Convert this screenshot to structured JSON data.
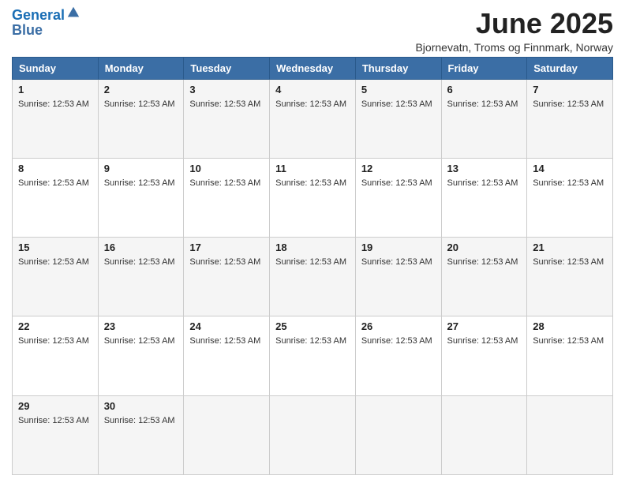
{
  "header": {
    "logo_line1": "General",
    "logo_line2": "Blue",
    "month_title": "June 2025",
    "location": "Bjornevatn, Troms og Finnmark, Norway"
  },
  "days_of_week": [
    "Sunday",
    "Monday",
    "Tuesday",
    "Wednesday",
    "Thursday",
    "Friday",
    "Saturday"
  ],
  "sunrise_time": "Sunrise: 12:53 AM",
  "weeks": [
    [
      {
        "day": "1",
        "info": "Sunrise: 12:53 AM"
      },
      {
        "day": "2",
        "info": "Sunrise: 12:53 AM"
      },
      {
        "day": "3",
        "info": "Sunrise: 12:53 AM"
      },
      {
        "day": "4",
        "info": "Sunrise: 12:53 AM"
      },
      {
        "day": "5",
        "info": "Sunrise: 12:53 AM"
      },
      {
        "day": "6",
        "info": "Sunrise: 12:53 AM"
      },
      {
        "day": "7",
        "info": "Sunrise: 12:53 AM"
      }
    ],
    [
      {
        "day": "8",
        "info": "Sunrise: 12:53 AM"
      },
      {
        "day": "9",
        "info": "Sunrise: 12:53 AM"
      },
      {
        "day": "10",
        "info": "Sunrise: 12:53 AM"
      },
      {
        "day": "11",
        "info": "Sunrise: 12:53 AM"
      },
      {
        "day": "12",
        "info": "Sunrise: 12:53 AM"
      },
      {
        "day": "13",
        "info": "Sunrise: 12:53 AM"
      },
      {
        "day": "14",
        "info": "Sunrise: 12:53 AM"
      }
    ],
    [
      {
        "day": "15",
        "info": "Sunrise: 12:53 AM"
      },
      {
        "day": "16",
        "info": "Sunrise: 12:53 AM"
      },
      {
        "day": "17",
        "info": "Sunrise: 12:53 AM"
      },
      {
        "day": "18",
        "info": "Sunrise: 12:53 AM"
      },
      {
        "day": "19",
        "info": "Sunrise: 12:53 AM"
      },
      {
        "day": "20",
        "info": "Sunrise: 12:53 AM"
      },
      {
        "day": "21",
        "info": "Sunrise: 12:53 AM"
      }
    ],
    [
      {
        "day": "22",
        "info": "Sunrise: 12:53 AM"
      },
      {
        "day": "23",
        "info": "Sunrise: 12:53 AM"
      },
      {
        "day": "24",
        "info": "Sunrise: 12:53 AM"
      },
      {
        "day": "25",
        "info": "Sunrise: 12:53 AM"
      },
      {
        "day": "26",
        "info": "Sunrise: 12:53 AM"
      },
      {
        "day": "27",
        "info": "Sunrise: 12:53 AM"
      },
      {
        "day": "28",
        "info": "Sunrise: 12:53 AM"
      }
    ],
    [
      {
        "day": "29",
        "info": "Sunrise: 12:53 AM"
      },
      {
        "day": "30",
        "info": "Sunrise: 12:53 AM"
      },
      {
        "day": "",
        "info": ""
      },
      {
        "day": "",
        "info": ""
      },
      {
        "day": "",
        "info": ""
      },
      {
        "day": "",
        "info": ""
      },
      {
        "day": "",
        "info": ""
      }
    ]
  ]
}
